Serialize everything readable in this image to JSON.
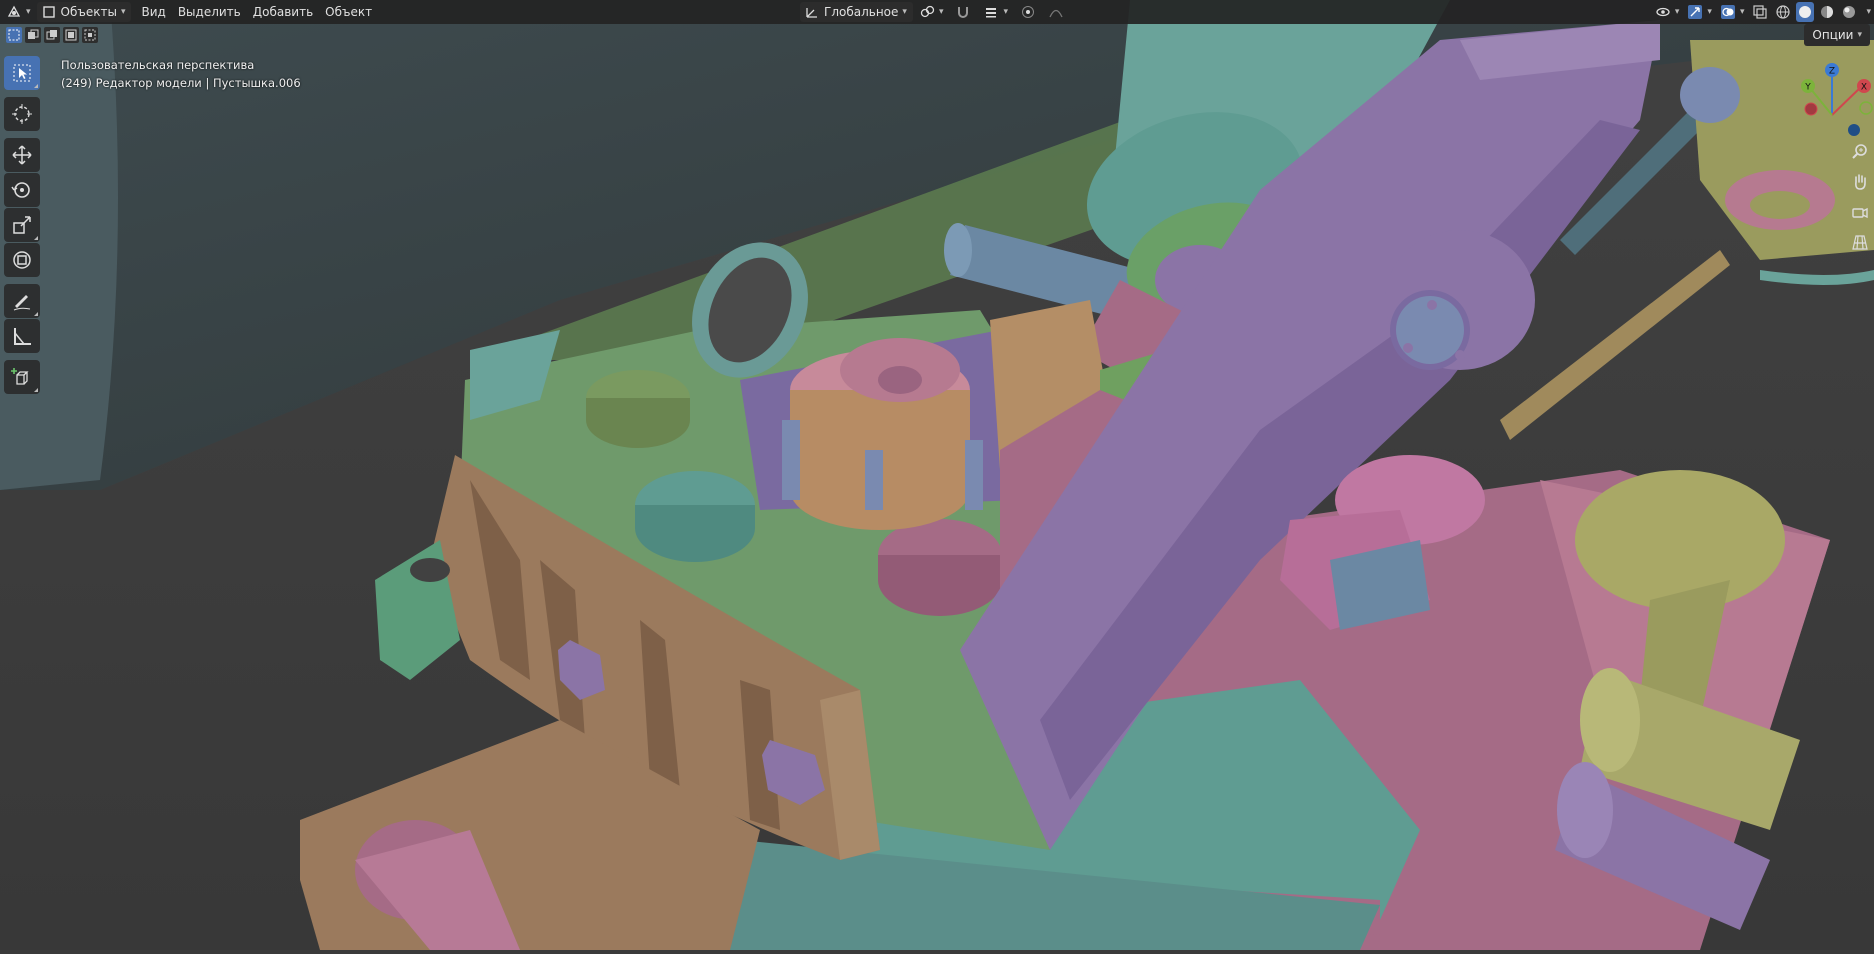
{
  "header": {
    "mode_label": "Объекты",
    "menu": [
      "Вид",
      "Выделить",
      "Добавить",
      "Объект"
    ],
    "transform_orientation": "Глобальное"
  },
  "viewport": {
    "view_name": "Пользовательская перспектива",
    "info_line": "(249) Редактор модели | Пустышка.006",
    "options_label": "Опции"
  },
  "gizmo": {
    "x": "X",
    "y": "Y",
    "z": "Z"
  },
  "colors": {
    "accent": "#4772b3",
    "green": "#6f9a6b",
    "pink": "#a56b86",
    "tan": "#9b7a5d",
    "teal": "#5f9c92",
    "purple": "#8b74a6",
    "blue": "#6b88a3",
    "olive": "#9a9b5e"
  }
}
